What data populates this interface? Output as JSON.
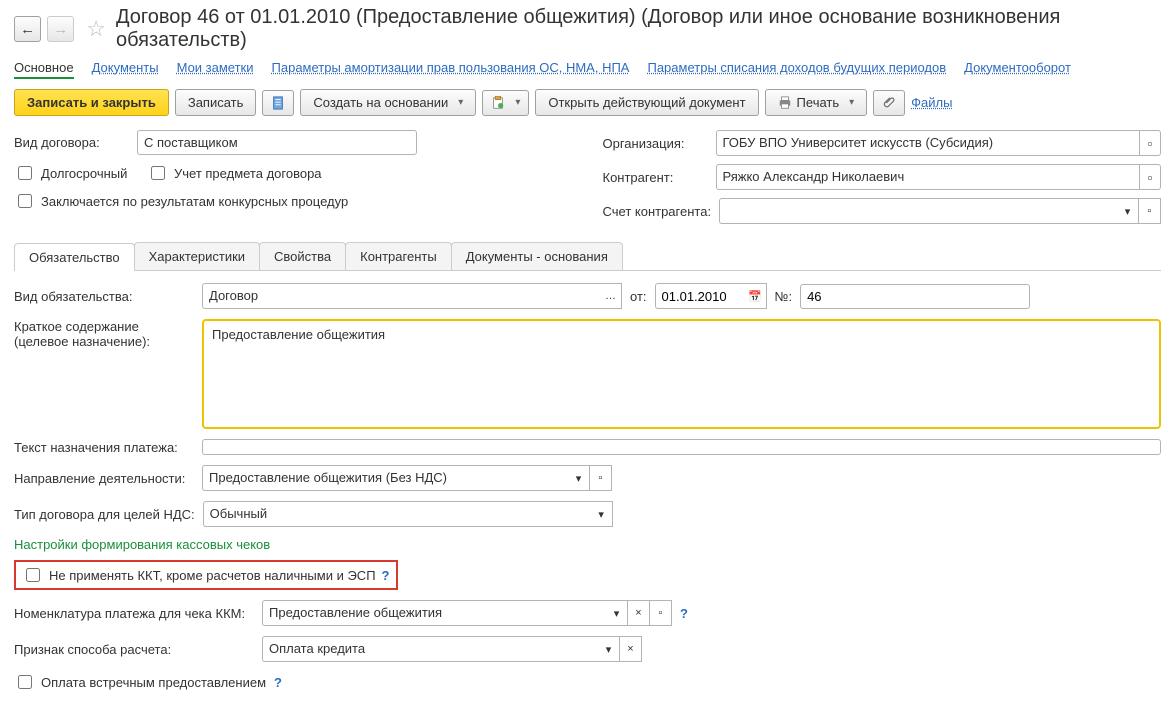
{
  "header": {
    "title": "Договор 46 от 01.01.2010 (Предоставление общежития) (Договор или иное основание возникновения обязательств)"
  },
  "nav": {
    "items": [
      {
        "label": "Основное",
        "active": true
      },
      {
        "label": "Документы"
      },
      {
        "label": "Мои заметки"
      },
      {
        "label": "Параметры амортизации прав пользования ОС, НМА, НПА"
      },
      {
        "label": "Параметры списания доходов будущих периодов"
      },
      {
        "label": "Документооборот"
      }
    ]
  },
  "toolbar": {
    "save_close": "Записать и закрыть",
    "save": "Записать",
    "create_based": "Создать на основании",
    "open_current": "Открыть действующий документ",
    "print": "Печать",
    "files": "Файлы"
  },
  "top_form": {
    "contract_type_label": "Вид договора:",
    "contract_type_value": "С поставщиком",
    "long_term": "Долгосрочный",
    "subject_accounting": "Учет предмета договора",
    "tender": "Заключается по результатам конкурсных процедур",
    "org_label": "Организация:",
    "org_value": "ГОБУ ВПО Университет искусств (Субсидия)",
    "counterparty_label": "Контрагент:",
    "counterparty_value": "Ряжко Александр Николаевич",
    "account_label": "Счет контрагента:",
    "account_value": ""
  },
  "tabs": {
    "items": [
      {
        "label": "Обязательство",
        "active": true
      },
      {
        "label": "Характеристики"
      },
      {
        "label": "Свойства"
      },
      {
        "label": "Контрагенты"
      },
      {
        "label": "Документы - основания"
      }
    ]
  },
  "obligation": {
    "type_label": "Вид обязательства:",
    "type_value": "Договор",
    "date_label": "от:",
    "date_value": "01.01.2010",
    "num_label": "№:",
    "num_value": "46",
    "summary_label1": "Краткое содержание",
    "summary_label2": "(целевое назначение):",
    "summary_value": "Предоставление общежития",
    "payment_text_label": "Текст назначения платежа:",
    "payment_text_value": "",
    "activity_label": "Направление деятельности:",
    "activity_value": "Предоставление общежития (Без НДС)",
    "vat_type_label": "Тип договора для целей НДС:",
    "vat_type_value": "Обычный",
    "cash_section": "Настройки формирования кассовых чеков",
    "no_kkt": "Не применять ККТ, кроме расчетов наличными и ЭСП",
    "nomenclature_label": "Номенклатура платежа для чека ККМ:",
    "nomenclature_value": "Предоставление общежития",
    "payment_method_label": "Признак способа расчета:",
    "payment_method_value": "Оплата кредита",
    "counter_payment": "Оплата встречным предоставлением"
  }
}
